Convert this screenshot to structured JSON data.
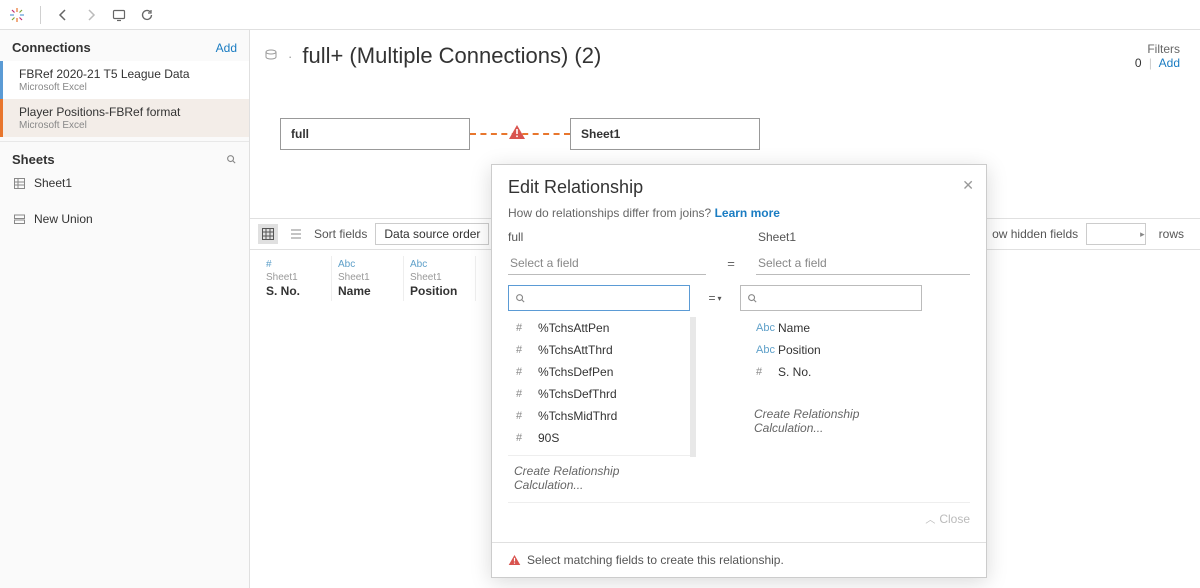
{
  "toolbar": {
    "back": "←",
    "forward": "→"
  },
  "connections": {
    "title": "Connections",
    "add": "Add",
    "items": [
      {
        "name": "FBRef 2020-21 T5 League Data",
        "type": "Microsoft Excel"
      },
      {
        "name": "Player Positions-FBRef format",
        "type": "Microsoft Excel"
      }
    ]
  },
  "sheets": {
    "title": "Sheets",
    "items": [
      "Sheet1"
    ],
    "new_union": "New Union"
  },
  "datasource": {
    "title": "full+ (Multiple Connections) (2)",
    "filters_label": "Filters",
    "filters_count": "0",
    "filters_add": "Add"
  },
  "canvas": {
    "left_table": "full",
    "right_table": "Sheet1"
  },
  "grid": {
    "sort_label": "Sort fields",
    "sort_value": "Data source order",
    "hidden_fields": "ow hidden fields",
    "rows_label": "rows",
    "columns": [
      {
        "type": "#",
        "sheet": "Sheet1",
        "name": "S. No."
      },
      {
        "type": "Abc",
        "sheet": "Sheet1",
        "name": "Name"
      },
      {
        "type": "Abc",
        "sheet": "Sheet1",
        "name": "Position"
      }
    ]
  },
  "dialog": {
    "title": "Edit Relationship",
    "subtitle": "How do relationships differ from joins?",
    "learn_more": "Learn more",
    "left_table": "full",
    "right_table": "Sheet1",
    "select_placeholder": "Select a field",
    "equals": "=",
    "left_fields": [
      {
        "type": "#",
        "name": "%TchsAttPen"
      },
      {
        "type": "#",
        "name": "%TchsAttThrd"
      },
      {
        "type": "#",
        "name": "%TchsDefPen"
      },
      {
        "type": "#",
        "name": "%TchsDefThrd"
      },
      {
        "type": "#",
        "name": "%TchsMidThrd"
      },
      {
        "type": "#",
        "name": "90S"
      }
    ],
    "right_fields": [
      {
        "type": "Abc",
        "name": "Name"
      },
      {
        "type": "Abc",
        "name": "Position"
      },
      {
        "type": "#",
        "name": "S. No."
      }
    ],
    "create_calc": "Create Relationship Calculation...",
    "close": "Close",
    "footer_warn": "Select matching fields to create this relationship."
  }
}
